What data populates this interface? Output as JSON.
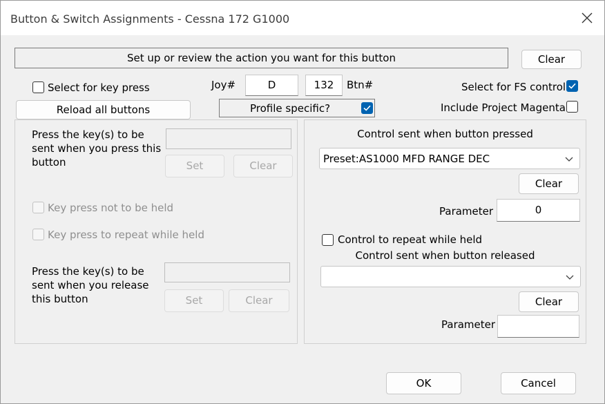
{
  "window": {
    "title": "Button & Switch Assignments - Cessna 172 G1000"
  },
  "top": {
    "instruction": "Set up or review the action you want for this button",
    "clear_label": "Clear"
  },
  "key_press": {
    "select_label": "Select for key press",
    "checked": false
  },
  "reload_label": "Reload all buttons",
  "joy": {
    "joy_label": "Joy#",
    "joy_value": "D",
    "btn_value": "132",
    "btn_label": "Btn#"
  },
  "profile": {
    "label": "Profile specific?",
    "checked": true
  },
  "fs": {
    "label": "Select for FS control",
    "checked": true
  },
  "magenta": {
    "label": "Include Project Magenta",
    "checked": false
  },
  "left_panel": {
    "press_label": "Press the key(s) to be sent when you press this button",
    "press_value": "",
    "set_label": "Set",
    "clear_label": "Clear",
    "not_held_label": "Key press not to be held",
    "repeat_label": "Key press to repeat while held",
    "release_label": "Press the key(s) to be sent when you release this button",
    "release_value": "",
    "set2_label": "Set",
    "clear2_label": "Clear"
  },
  "right_panel": {
    "pressed_heading": "Control sent when button pressed",
    "pressed_control": "Preset:AS1000 MFD RANGE DEC",
    "clear_label": "Clear",
    "param_label": "Parameter",
    "param_value": "0",
    "repeat_label": "Control to repeat while held",
    "released_heading": "Control sent when button released",
    "released_control": "",
    "clear2_label": "Clear",
    "param2_label": "Parameter",
    "param2_value": ""
  },
  "footer": {
    "ok_label": "OK",
    "cancel_label": "Cancel"
  },
  "colors": {
    "accent": "#0063b1",
    "window_bg": "#f0f0f0",
    "title_bg": "#ffffff"
  },
  "icons": {
    "close": "close-icon",
    "check": "checkmark-icon",
    "dropdown": "chevron-down-icon"
  }
}
